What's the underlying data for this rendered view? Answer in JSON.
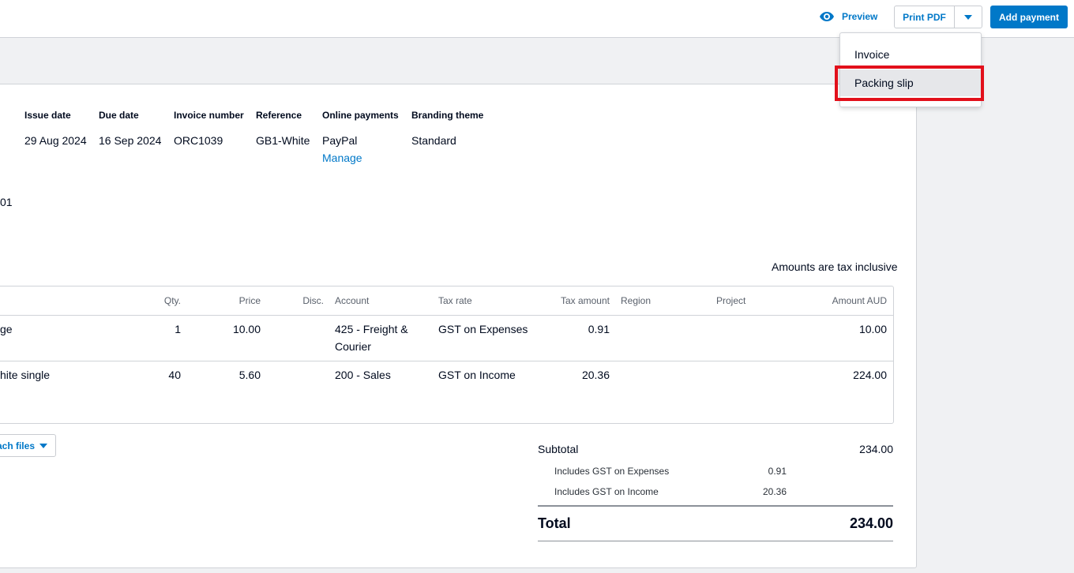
{
  "header": {
    "preview_label": "Preview",
    "print_pdf_label": "Print PDF",
    "add_payment_label": "Add payment"
  },
  "dropdown": {
    "items": [
      {
        "label": "Invoice"
      },
      {
        "label": "Packing slip"
      }
    ],
    "highlight_color": "#e2101b"
  },
  "invoice_meta": {
    "issue_date_label": "Issue date",
    "issue_date": "29 Aug 2024",
    "due_date_label": "Due date",
    "due_date": "16 Sep 2024",
    "invoice_number_label": "Invoice number",
    "invoice_number": "ORC1039",
    "reference_label": "Reference",
    "reference": "GB1-White",
    "online_payments_label": "Online payments",
    "online_payments": "PayPal",
    "manage_link": "Manage",
    "branding_theme_label": "Branding theme",
    "branding_theme": "Standard",
    "partial_text": "01"
  },
  "tax_note": "Amounts are tax inclusive",
  "table": {
    "headers": {
      "qty": "Qty.",
      "price": "Price",
      "disc": "Disc.",
      "account": "Account",
      "tax_rate": "Tax rate",
      "tax_amount": "Tax amount",
      "region": "Region",
      "project": "Project",
      "amount": "Amount AUD"
    },
    "rows": [
      {
        "description": "ge",
        "qty": "1",
        "price": "10.00",
        "account_line1": "425 - Freight &",
        "account_line2": "Courier",
        "tax_rate": "GST on Expenses",
        "tax_amount": "0.91",
        "amount": "10.00"
      },
      {
        "description": "hite single",
        "qty": "40",
        "price": "5.60",
        "account_line1": "200 - Sales",
        "account_line2": "",
        "tax_rate": "GST on Income",
        "tax_amount": "20.36",
        "amount": "224.00"
      }
    ]
  },
  "attach_label": "ach files",
  "summary": {
    "subtotal_label": "Subtotal",
    "subtotal": "234.00",
    "gst_expenses_label": "Includes GST on Expenses",
    "gst_expenses": "0.91",
    "gst_income_label": "Includes GST on Income",
    "gst_income": "20.36",
    "total_label": "Total",
    "total": "234.00"
  },
  "colors": {
    "accent": "#0078c8",
    "page_bg": "#f0f1f3",
    "hover_bg": "#e6e7ea"
  },
  "icons": {
    "preview": "eye-icon",
    "caret": "caret-down-icon"
  }
}
